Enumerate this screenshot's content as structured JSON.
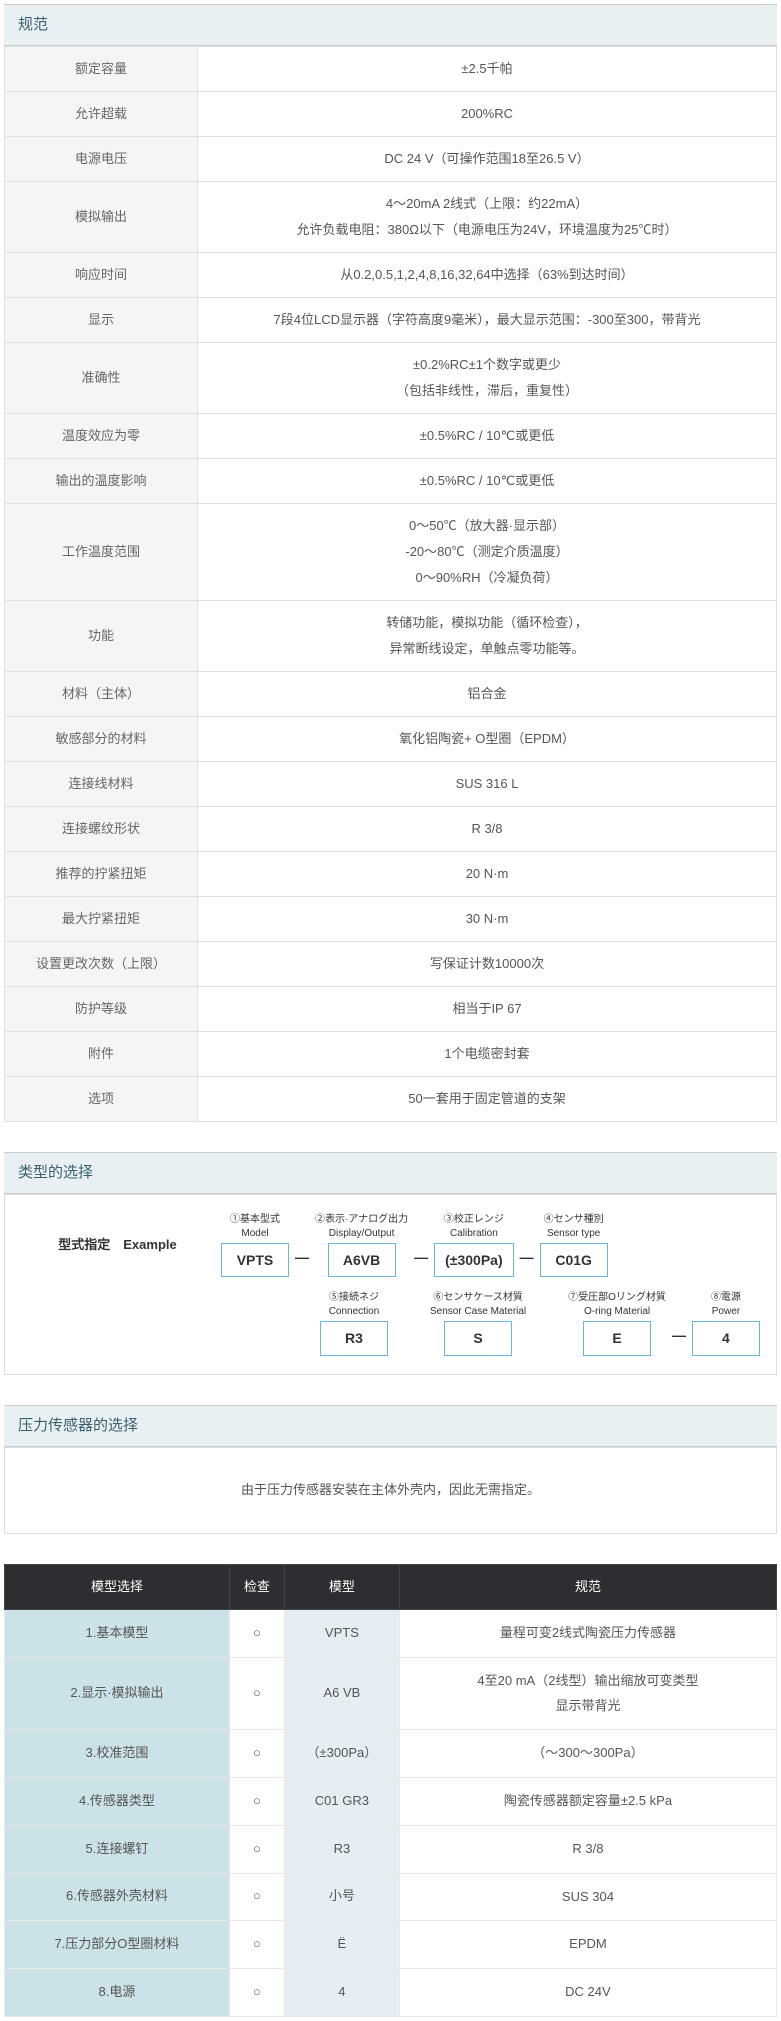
{
  "sections": {
    "spec": "规范",
    "type": "类型的选择",
    "sensor": "压力传感器的选择"
  },
  "specs": [
    {
      "l": "额定容量",
      "v": "±2.5千帕"
    },
    {
      "l": "允许超载",
      "v": "200%RC"
    },
    {
      "l": "电源电压",
      "v": "DC 24 V（可操作范围18至26.5 V）"
    },
    {
      "l": "模拟输出",
      "v": "4～20mA 2线式（上限：约22mA）<br>允许负载电阻：380Ω以下（电源电压为24V，环境温度为25℃时）"
    },
    {
      "l": "响应时间",
      "v": "从0.2,0.5,1,2,4,8,16,32,64中选择（63%到达时间）"
    },
    {
      "l": "显示",
      "v": "7段4位LCD显示器（字符高度9毫米），最大显示范围：-300至300，带背光"
    },
    {
      "l": "准确性",
      "v": "±0.2%RC±1个数字或更少<br>（包括非线性，滞后，重复性）"
    },
    {
      "l": "温度效应为零",
      "v": "±0.5%RC / 10℃或更低"
    },
    {
      "l": "输出的温度影响",
      "v": "±0.5%RC / 10℃或更低"
    },
    {
      "l": "工作温度范围",
      "v": "0～50℃（放大器·显示部）<br>-20～80℃（测定介质温度）<br>0～90%RH（冷凝负荷）"
    },
    {
      "l": "功能",
      "v": "转储功能，模拟功能（循环检查），<br>异常断线设定，单触点零功能等。"
    },
    {
      "l": "材料（主体）",
      "v": "铝合金"
    },
    {
      "l": "敏感部分的材料",
      "v": "氧化铝陶瓷+ O型圈（EPDM）"
    },
    {
      "l": "连接线材料",
      "v": "SUS 316 L"
    },
    {
      "l": "连接螺纹形状",
      "v": "R 3/8"
    },
    {
      "l": "推荐的拧紧扭矩",
      "v": "20 N·m"
    },
    {
      "l": "最大拧紧扭矩",
      "v": "30 N·m"
    },
    {
      "l": "设置更改次数（上限）",
      "v": "写保证计数10000次"
    },
    {
      "l": "防护等级",
      "v": "相当于IP 67"
    },
    {
      "l": "附件",
      "v": "1个电缆密封套"
    },
    {
      "l": "选项",
      "v": "50一套用于固定管道的支架"
    }
  ],
  "typeSel": {
    "prefix": "型式指定　Example",
    "row1": [
      {
        "t": "①基本型式<br>Model",
        "c": "VPTS"
      },
      {
        "t": "②表示·アナログ出力<br>Display/Output",
        "c": "A6VB"
      },
      {
        "t": "③校正レンジ<br>Calibration",
        "c": "(±300Pa)"
      },
      {
        "t": "④センサ種別<br>Sensor type",
        "c": "C01G"
      }
    ],
    "row2": [
      {
        "t": "⑤接続ネジ<br>Connection",
        "c": "R3"
      },
      {
        "t": "⑥センサケース材質<br>Sensor Case Material",
        "c": "S"
      },
      {
        "t": "⑦受圧部Oリング材質<br>O-ring Material",
        "c": "E"
      },
      {
        "t": "⑧電源<br>Power",
        "c": "4"
      }
    ]
  },
  "sensorNote": "由于压力传感器安装在主体外壳内，因此无需指定。",
  "modelTable": {
    "headers": [
      "模型选择",
      "检查",
      "模型",
      "规范"
    ],
    "rows": [
      {
        "s": "1.基本模型",
        "c": "○",
        "m": "VPTS",
        "p": "量程可变2线式陶瓷压力传感器"
      },
      {
        "s": "2.显示·模拟输出",
        "c": "○",
        "m": "A6 VB",
        "p": "4至20 mA（2线型）输出缩放可变类型<br>显示带背光"
      },
      {
        "s": "3.校准范围",
        "c": "○",
        "m": "（±300Pa）",
        "p": "（～300～300Pa）"
      },
      {
        "s": "4.传感器类型",
        "c": "○",
        "m": "C01 GR3",
        "p": "陶瓷传感器额定容量±2.5 kPa"
      },
      {
        "s": "5.连接螺钉",
        "c": "○",
        "m": "R3",
        "p": "R 3/8"
      },
      {
        "s": "6.传感器外壳材料",
        "c": "○",
        "m": "小号",
        "p": "SUS 304"
      },
      {
        "s": "7.压力部分O型圈材料",
        "c": "○",
        "m": "Ë",
        "p": "EPDM"
      },
      {
        "s": "8.电源",
        "c": "○",
        "m": "4",
        "p": "DC 24V"
      }
    ]
  }
}
